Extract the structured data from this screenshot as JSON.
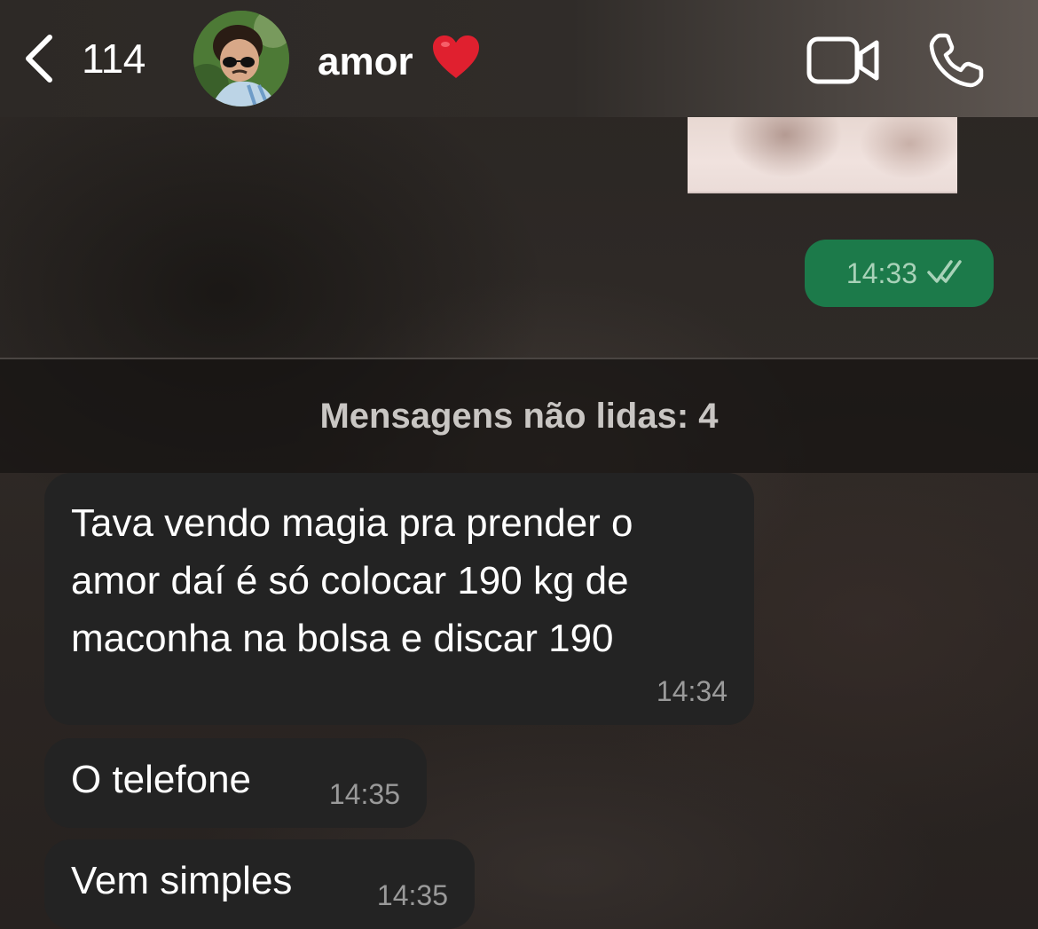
{
  "header": {
    "back_count": "114",
    "contact_name": "amor",
    "heart_icon": "heart-icon",
    "video_icon": "video-camera-icon",
    "call_icon": "phone-icon"
  },
  "messages": {
    "outgoing": [
      {
        "time": "14:33",
        "status_icon": "double-check-icon"
      }
    ],
    "unread_label": "Mensagens não lidas: 4",
    "incoming": [
      {
        "lines": [
          "Tava vendo magia pra prender o",
          "amor daí é só colocar 190 kg de",
          "maconha na bolsa e discar 190"
        ],
        "time": "14:34"
      },
      {
        "text": "O telefone",
        "time": "14:35"
      },
      {
        "text": "Vem simples",
        "time": "14:35"
      }
    ]
  },
  "colors": {
    "outgoing_bubble": "#1c7a4a",
    "incoming_bubble": "#232323",
    "heart": "#e0202f"
  }
}
